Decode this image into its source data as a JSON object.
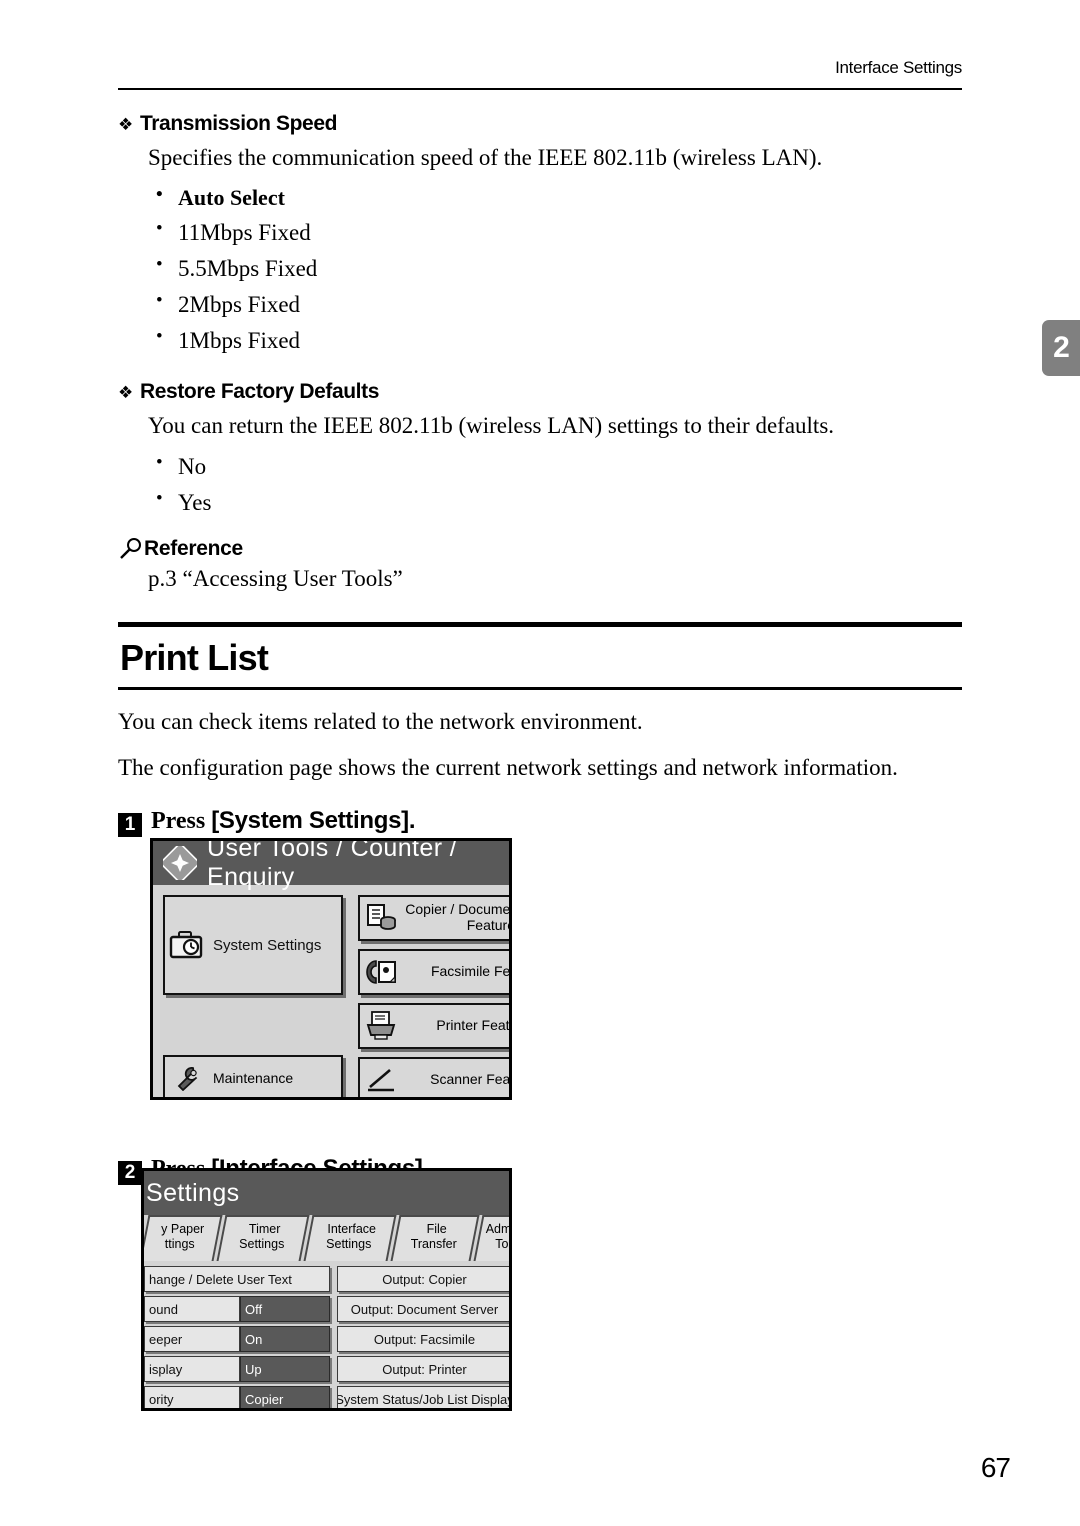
{
  "running_head": "Interface Settings",
  "chapter_tab": "2",
  "page_number": "67",
  "sections": [
    {
      "heading": "Transmission Speed",
      "body": "Specifies the communication speed of the IEEE 802.11b (wireless LAN).",
      "options": [
        "Auto Select",
        "11Mbps Fixed",
        "5.5Mbps Fixed",
        "2Mbps Fixed",
        "1Mbps Fixed"
      ]
    },
    {
      "heading": "Restore Factory Defaults",
      "body": "You can return the IEEE 802.11b (wireless LAN) settings to their defaults.",
      "options": [
        "No",
        "Yes"
      ]
    }
  ],
  "reference": {
    "label": "Reference",
    "text": "p.3 “Accessing User Tools”"
  },
  "print_list": {
    "title": "Print List",
    "paragraph_1": "You can check items related to the network environment.",
    "paragraph_2": "The configuration page shows the current network settings and network information."
  },
  "steps": [
    {
      "num": "1",
      "verb": "Press",
      "target": "[System Settings]."
    },
    {
      "num": "2",
      "verb": "Press",
      "target": "[Interface Settings]."
    }
  ],
  "lcd_user_tools": {
    "title": "User Tools / Counter / Enquiry",
    "system_settings": "System Settings",
    "maintenance": "Maintenance",
    "right_buttons": [
      {
        "line1": "Copier / Document",
        "line2": "Features"
      },
      {
        "line1": "Facsimile Feat",
        "line2": ""
      },
      {
        "line1": "Printer Featur",
        "line2": ""
      },
      {
        "line1": "Scanner Featu",
        "line2": ""
      }
    ]
  },
  "lcd_system_settings": {
    "title": "Settings",
    "tabs": [
      {
        "line1": "y Paper",
        "line2": "ttings"
      },
      {
        "line1": "Timer",
        "line2": "Settings"
      },
      {
        "line1": "Interface",
        "line2": "Settings"
      },
      {
        "line1": "File",
        "line2": "Transfer"
      },
      {
        "line1": "Administ",
        "line2": "Tool"
      }
    ],
    "left_rows": [
      {
        "name": "hange / Delete User Text",
        "value": ""
      },
      {
        "name": "ound",
        "value": "Off"
      },
      {
        "name": "eeper",
        "value": "On"
      },
      {
        "name": "isplay",
        "value": "Up"
      },
      {
        "name": "ority",
        "value": "Copier"
      }
    ],
    "right_rows": [
      "Output: Copier",
      "Output: Document Server",
      "Output: Facsimile",
      "Output: Printer",
      "System Status/Job List Display"
    ]
  }
}
